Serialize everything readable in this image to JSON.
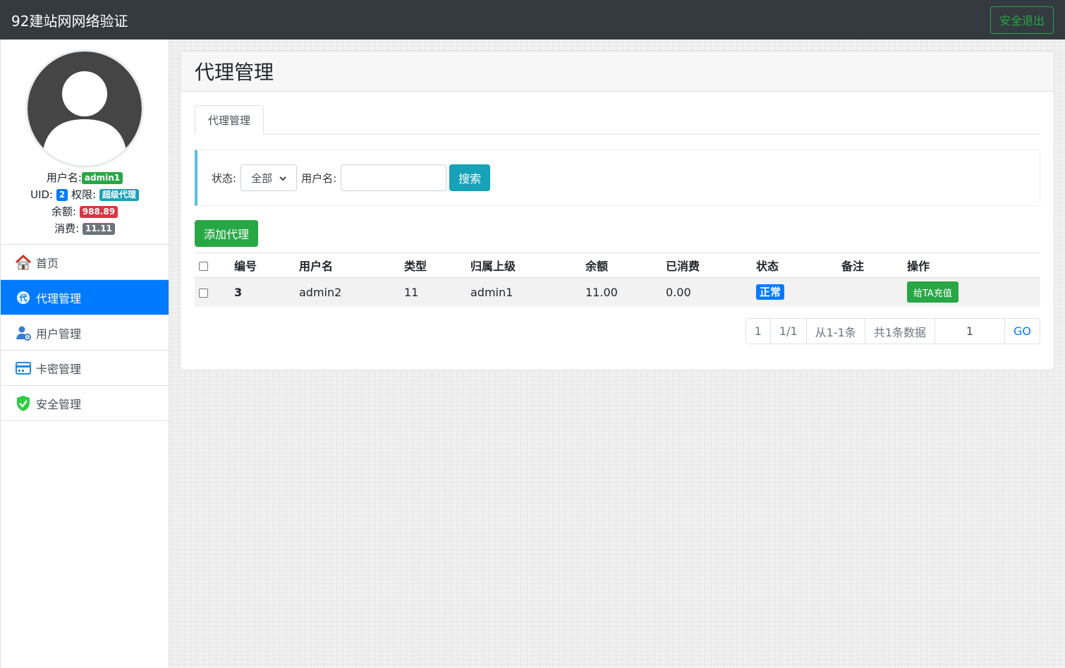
{
  "app": {
    "title": "92建站网网络验证",
    "logout_label": "安全退出"
  },
  "profile": {
    "username_label": "用户名:",
    "username": "admin1",
    "uid_label": "UID:",
    "uid": "2",
    "permission_label": "权限:",
    "permission": "超级代理",
    "balance_label": "余额:",
    "balance": "988.89",
    "consumed_label": "消费:",
    "consumed": "11.11"
  },
  "sidebar": {
    "items": [
      {
        "label": "首页",
        "icon": "home-icon",
        "active": false
      },
      {
        "label": "代理管理",
        "icon": "agent-icon",
        "active": true
      },
      {
        "label": "用户管理",
        "icon": "user-gear-icon",
        "active": false
      },
      {
        "label": "卡密管理",
        "icon": "card-icon",
        "active": false
      },
      {
        "label": "安全管理",
        "icon": "shield-check-icon",
        "active": false
      }
    ]
  },
  "main": {
    "title": "代理管理",
    "tab_label": "代理管理",
    "search": {
      "status_label": "状态:",
      "status_value": "全部",
      "username_label": "用户名:",
      "username_value": "",
      "search_label": "搜索"
    },
    "add_label": "添加代理",
    "table": {
      "headers": [
        "编号",
        "用户名",
        "类型",
        "归属上级",
        "余额",
        "已消费",
        "状态",
        "备注",
        "操作"
      ],
      "rows": [
        {
          "id": "3",
          "username": "admin2",
          "type": "11",
          "parent": "admin1",
          "balance": "11.00",
          "consumed": "0.00",
          "status": "正常",
          "remark": "",
          "action": "给TA充值"
        }
      ]
    },
    "pagination": {
      "page": "1",
      "page_of": "1/1",
      "range": "从1-1条",
      "total": "共1条数据",
      "goto_value": "1",
      "go_label": "GO"
    }
  },
  "colors": {
    "navbar": "#343a40",
    "primary": "#007bff",
    "success": "#28a745",
    "info": "#17a2b8",
    "danger": "#dc3545",
    "secondary": "#6c757d"
  }
}
